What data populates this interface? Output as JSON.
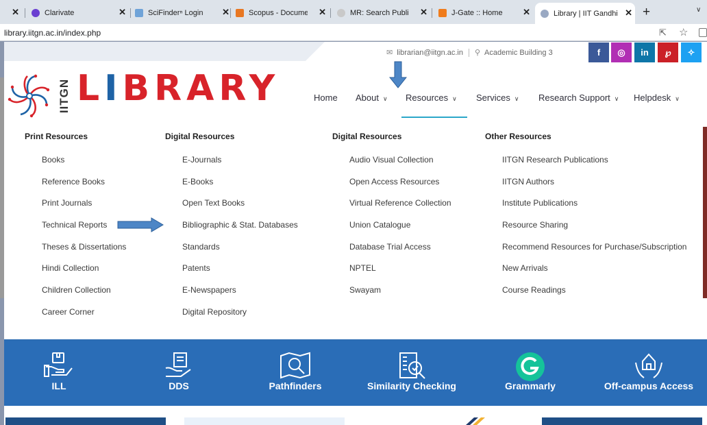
{
  "browser": {
    "tabs": [
      {
        "title": "",
        "favicon_color": "#dde3ea"
      },
      {
        "title": "Clarivate",
        "favicon_color": "#6a3fd1"
      },
      {
        "title": "SciFinderⁿ Login",
        "favicon_color": "#6fa3d8"
      },
      {
        "title": "Scopus - Documen",
        "favicon_color": "#e87722"
      },
      {
        "title": "MR: Search Publica",
        "favicon_color": "#c9c9c9"
      },
      {
        "title": "J-Gate :: Home",
        "favicon_color": "#f07c1c"
      },
      {
        "title": "Library | IIT Gandhi",
        "favicon_color": "#9aa9c3"
      }
    ],
    "active_tab_index": 6,
    "close_glyph": "✕",
    "new_tab_glyph": "+",
    "tab_menu_glyph": "∨",
    "url": "library.iitgn.ac.in/index.php"
  },
  "site": {
    "contact": {
      "email": "librarian@iitgn.ac.in",
      "location": "Academic Building 3"
    },
    "social": [
      {
        "name": "facebook",
        "glyph": "f",
        "color": "#3b5998"
      },
      {
        "name": "instagram",
        "glyph": "◎",
        "color": "#b12fb4"
      },
      {
        "name": "linkedin",
        "glyph": "in",
        "color": "#0e76a8"
      },
      {
        "name": "pinterest",
        "glyph": "℘",
        "color": "#cb2027"
      },
      {
        "name": "twitter",
        "glyph": "✧",
        "color": "#1da1f2"
      }
    ],
    "logo": {
      "side_text": "IITGN",
      "word_first": "L",
      "word_book": "I",
      "word_rest": "BRARY"
    },
    "nav": [
      {
        "label": "Home",
        "dropdown": false
      },
      {
        "label": "About",
        "dropdown": true
      },
      {
        "label": "Resources",
        "dropdown": true,
        "active": true
      },
      {
        "label": "Services",
        "dropdown": true
      },
      {
        "label": "Research Support",
        "dropdown": true
      },
      {
        "label": "Helpdesk",
        "dropdown": true
      }
    ],
    "mega_menu": {
      "columns": [
        {
          "heading": "Print Resources",
          "items": [
            "Books",
            "Reference Books",
            "Print Journals",
            "Technical Reports",
            "Theses & Dissertations",
            "Hindi Collection",
            "Children Collection",
            "Career Corner"
          ]
        },
        {
          "heading": "Digital Resources",
          "items": [
            "E-Journals",
            "E-Books",
            "Open Text Books",
            "Bibliographic & Stat. Databases",
            "Standards",
            "Patents",
            "E-Newspapers",
            "Digital Repository"
          ]
        },
        {
          "heading": "Digital Resources",
          "items": [
            "Audio Visual Collection",
            "Open Access Resources",
            "Virtual Reference Collection",
            "Union Catalogue",
            "Database Trial Access",
            "NPTEL",
            "Swayam"
          ]
        },
        {
          "heading": "Other Resources",
          "items": [
            "IITGN Research Publications",
            "IITGN Authors",
            "Institute Publications",
            "Resource Sharing",
            "Recommend Resources for Purchase/Subscription",
            "New Arrivals",
            "Course Readings"
          ]
        }
      ]
    },
    "services": [
      {
        "label": "ILL",
        "icon": "hand-box-icon"
      },
      {
        "label": "DDS",
        "icon": "hand-document-icon"
      },
      {
        "label": "Pathfinders",
        "icon": "map-search-icon"
      },
      {
        "label": "Similarity Checking",
        "icon": "document-check-icon"
      },
      {
        "label": "Grammarly",
        "icon": "grammarly-icon"
      },
      {
        "label": "Off-campus Access",
        "icon": "building-hands-icon"
      }
    ]
  },
  "colors": {
    "brand_red": "#d8232a",
    "brand_blue": "#1e63a6",
    "services_bar": "#2a6db7",
    "annotation_arrow": "#4d86c6"
  }
}
